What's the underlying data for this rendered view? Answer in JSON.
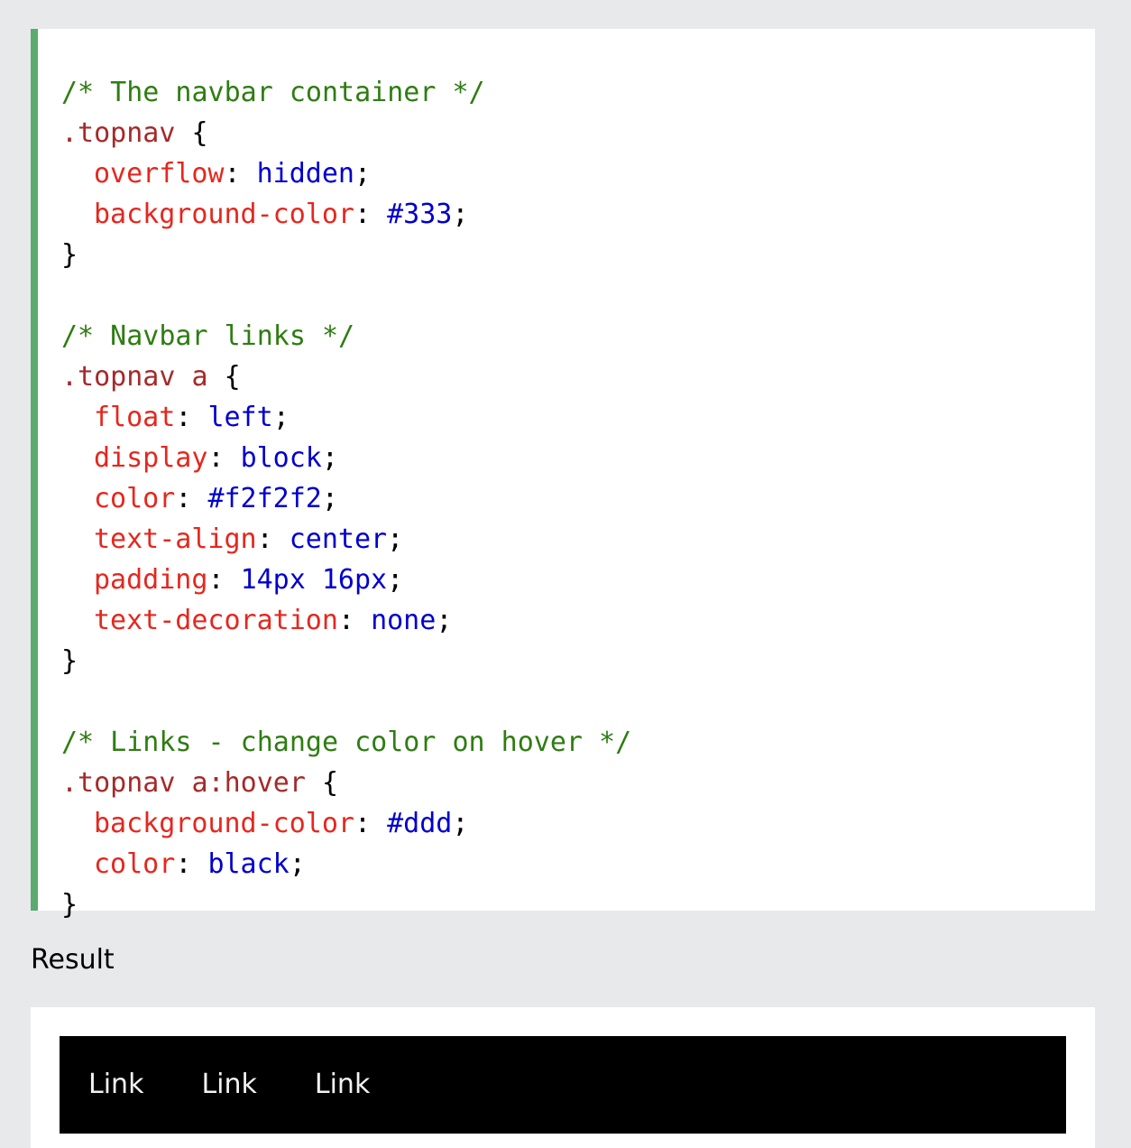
{
  "code": {
    "blocks": [
      {
        "comment": "/* The navbar container */",
        "selector": ".topnav",
        "declarations": [
          {
            "prop": "overflow",
            "value": "hidden"
          },
          {
            "prop": "background-color",
            "value": "#333"
          }
        ]
      },
      {
        "comment": "/* Navbar links */",
        "selector": ".topnav a",
        "declarations": [
          {
            "prop": "float",
            "value": "left"
          },
          {
            "prop": "display",
            "value": "block"
          },
          {
            "prop": "color",
            "value": "#f2f2f2"
          },
          {
            "prop": "text-align",
            "value": "center"
          },
          {
            "prop": "padding",
            "value": "14px 16px"
          },
          {
            "prop": "text-decoration",
            "value": "none"
          }
        ]
      },
      {
        "comment": "/* Links - change color on hover */",
        "selector": ".topnav a:hover",
        "declarations": [
          {
            "prop": "background-color",
            "value": "#ddd"
          },
          {
            "prop": "color",
            "value": "black"
          }
        ]
      }
    ],
    "open_brace": "{",
    "close_brace": "}"
  },
  "result": {
    "label": "Result",
    "links": [
      "Link",
      "Link",
      "Link"
    ]
  },
  "colors": {
    "page_bg": "#e7e9eb",
    "accent_border": "#59ab6e",
    "comment": "#2e7d12",
    "selector": "#a52a2a",
    "property": "#e5271e",
    "value": "#0000cd",
    "navbar_bg": "#000000",
    "link_text": "#f2f2f2"
  }
}
